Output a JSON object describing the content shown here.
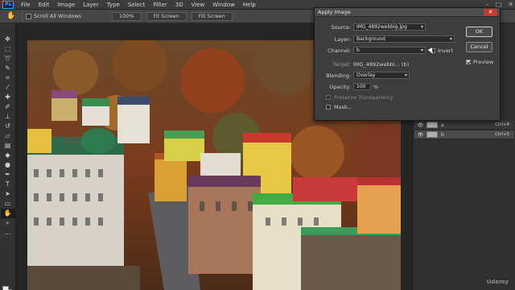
{
  "menubar": {
    "logo": "Ps",
    "items": [
      "File",
      "Edit",
      "Image",
      "Layer",
      "Type",
      "Select",
      "Filter",
      "3D",
      "View",
      "Window",
      "Help"
    ],
    "window_controls": [
      "–",
      "□",
      "✕"
    ]
  },
  "options": {
    "scroll_all_windows": "Scroll All Windows",
    "zoom_level": "100%",
    "fit_screen": "Fit Screen",
    "fill_screen": "Fill Screen"
  },
  "dialog": {
    "title": "Apply Image",
    "source_label": "Source:",
    "source_value": "IMG_4892webbig.jpg",
    "layer_label": "Layer:",
    "layer_value": "Background",
    "channel_label": "Channel:",
    "channel_value": "b",
    "invert_label": "Invert",
    "target_label": "Target:",
    "target_value": "IMG_4892webbi... (b)",
    "blending_label": "Blending:",
    "blending_value": "Overlay",
    "opacity_label": "Opacity:",
    "opacity_value": "100",
    "opacity_unit": "%",
    "preserve_transparency_label": "Preserve Transparency",
    "mask_label": "Mask...",
    "ok_label": "OK",
    "cancel_label": "Cancel",
    "preview_label": "Preview",
    "preview_checked": true,
    "invert_checked": false
  },
  "layers": [
    {
      "name": "a",
      "shortcut": "Ctrl+4"
    },
    {
      "name": "b",
      "shortcut": "Ctrl+5"
    }
  ],
  "watermark": "Udemy",
  "colors": {
    "close_button": "#c43b2e",
    "panel_bg": "#3d3d3d"
  }
}
